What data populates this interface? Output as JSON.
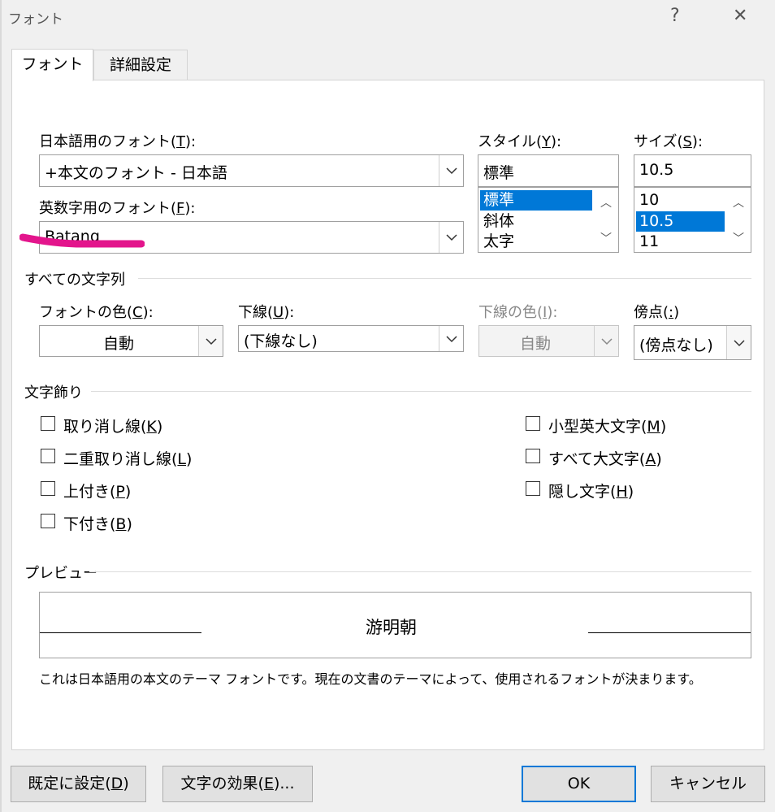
{
  "window": {
    "title": "フォント",
    "help_glyph": "?",
    "close_glyph": "✕"
  },
  "tabs": [
    {
      "label": "フォント"
    },
    {
      "label": "詳細設定"
    }
  ],
  "japanese_font": {
    "label": "日本語用のフォント(",
    "key": "T",
    "label_end": "):",
    "value": "+本文のフォント - 日本語"
  },
  "latin_font": {
    "label": "英数字用のフォント(",
    "key": "F",
    "label_end": "):",
    "value": "Batang"
  },
  "style": {
    "label": "スタイル(",
    "key": "Y",
    "label_end": "):",
    "value": "標準",
    "options": [
      "標準",
      "斜体",
      "太字"
    ],
    "selected_index": 0
  },
  "size": {
    "label": "サイズ(",
    "key": "S",
    "label_end": "):",
    "value": "10.5",
    "options": [
      "10",
      "10.5",
      "11"
    ],
    "selected_index": 1
  },
  "all_text": {
    "section_title": "すべての文字列",
    "font_color": {
      "label": "フォントの色(",
      "key": "C",
      "label_end": "):",
      "value": "自動"
    },
    "underline": {
      "label": "下線(",
      "key": "U",
      "label_end": "):",
      "value": "(下線なし)"
    },
    "underline_color": {
      "label": "下線の色(",
      "key": "I",
      "label_end": "):",
      "value": "自動"
    },
    "emphasis": {
      "label": "傍点(",
      "key": ":",
      "label_end": ")",
      "value": "(傍点なし)"
    }
  },
  "effects": {
    "section_title": "文字飾り",
    "left": [
      {
        "label": "取り消し線(",
        "key": "K",
        "end": ")",
        "checked": false
      },
      {
        "label": "二重取り消し線(",
        "key": "L",
        "end": ")",
        "checked": false
      },
      {
        "label": "上付き(",
        "key": "P",
        "end": ")",
        "checked": false
      },
      {
        "label": "下付き(",
        "key": "B",
        "end": ")",
        "checked": false
      }
    ],
    "right": [
      {
        "label": "小型英大文字(",
        "key": "M",
        "end": ")",
        "checked": false
      },
      {
        "label": "すべて大文字(",
        "key": "A",
        "end": ")",
        "checked": false
      },
      {
        "label": "隠し文字(",
        "key": "H",
        "end": ")",
        "checked": false
      }
    ]
  },
  "preview": {
    "section_title": "プレビュー",
    "sample": "游明朝",
    "note": "これは日本語用の本文のテーマ フォントです。現在の文書のテーマによって、使用されるフォントが決まります。"
  },
  "buttons": {
    "set_default": {
      "label": "既定に設定(",
      "key": "D",
      "end": ")"
    },
    "text_effects": {
      "label": "文字の効果(",
      "key": "E",
      "end": ")..."
    },
    "ok": "OK",
    "cancel": "キャンセル"
  },
  "colors": {
    "selection": "#0078d7",
    "annotation_marker": "#e3158c",
    "default_button_border": "#0078d7"
  }
}
